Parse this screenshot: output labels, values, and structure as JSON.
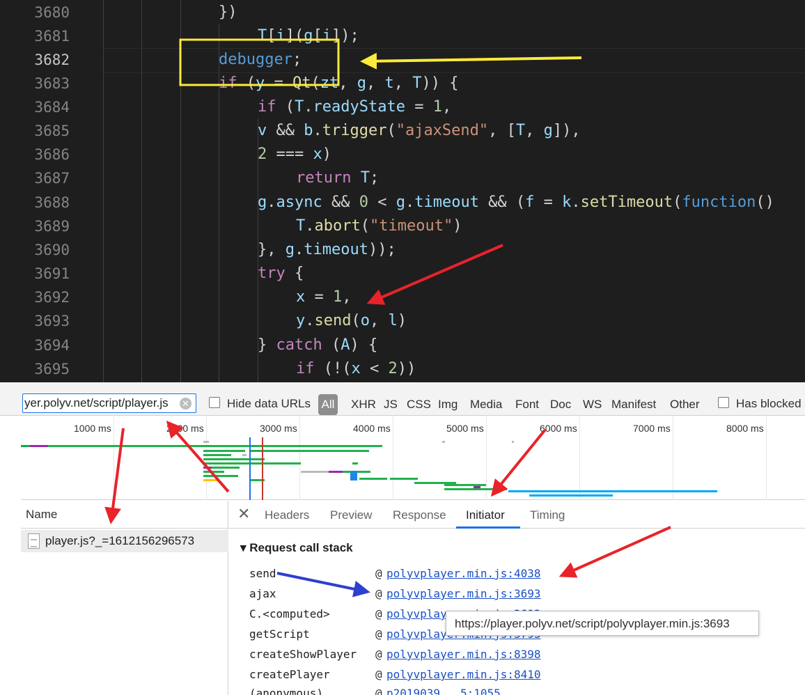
{
  "editor": {
    "active_line": "3682",
    "lines": [
      {
        "num": "3680"
      },
      {
        "num": "3681"
      },
      {
        "num": "3682"
      },
      {
        "num": "3683"
      },
      {
        "num": "3684"
      },
      {
        "num": "3685"
      },
      {
        "num": "3686"
      },
      {
        "num": "3687"
      },
      {
        "num": "3688"
      },
      {
        "num": "3689"
      },
      {
        "num": "3690"
      },
      {
        "num": "3691"
      },
      {
        "num": "3692"
      },
      {
        "num": "3693"
      },
      {
        "num": "3694"
      },
      {
        "num": "3695"
      }
    ]
  },
  "filter": {
    "value": "yer.polyv.net/script/player.js",
    "hide_data_urls": "Hide data URLs",
    "has_blocked": "Has blocked",
    "types": [
      "All",
      "XHR",
      "JS",
      "CSS",
      "Img",
      "Media",
      "Font",
      "Doc",
      "WS",
      "Manifest",
      "Other"
    ]
  },
  "timeline": {
    "ticks": [
      "1000 ms",
      "2000 ms",
      "3000 ms",
      "4000 ms",
      "5000 ms",
      "6000 ms",
      "7000 ms",
      "8000 ms"
    ]
  },
  "requests": {
    "header": "Name",
    "rows": [
      {
        "name": "player.js?_=1612156296573"
      }
    ]
  },
  "details": {
    "tabs": [
      "Headers",
      "Preview",
      "Response",
      "Initiator",
      "Timing"
    ],
    "active_tab": "Initiator",
    "call_stack_title": "Request call stack",
    "frames": [
      {
        "fn": "send",
        "link": "polyvplayer.min.js:4038"
      },
      {
        "fn": "ajax",
        "link": "polyvplayer.min.js:3693"
      },
      {
        "fn": "C.<computed>",
        "link": "polyvplayer.min.js:3693"
      },
      {
        "fn": "getScript",
        "link": "polyvplayer.min.js:3793"
      },
      {
        "fn": "createShowPlayer",
        "link": "polyvplayer.min.js:8398"
      },
      {
        "fn": "createPlayer",
        "link": "polyvplayer.min.js:8410"
      },
      {
        "fn": "(anonymous)",
        "link": "p2019039...5:1055"
      }
    ],
    "tooltip": "https://player.polyv.net/script/polyvplayer.min.js:3693"
  },
  "colors": {
    "highlight_box": "#ffeb3b",
    "arrow_red": "#e8232a",
    "arrow_yellow": "#ffeb3b",
    "arrow_blue": "#2f3fd0"
  }
}
